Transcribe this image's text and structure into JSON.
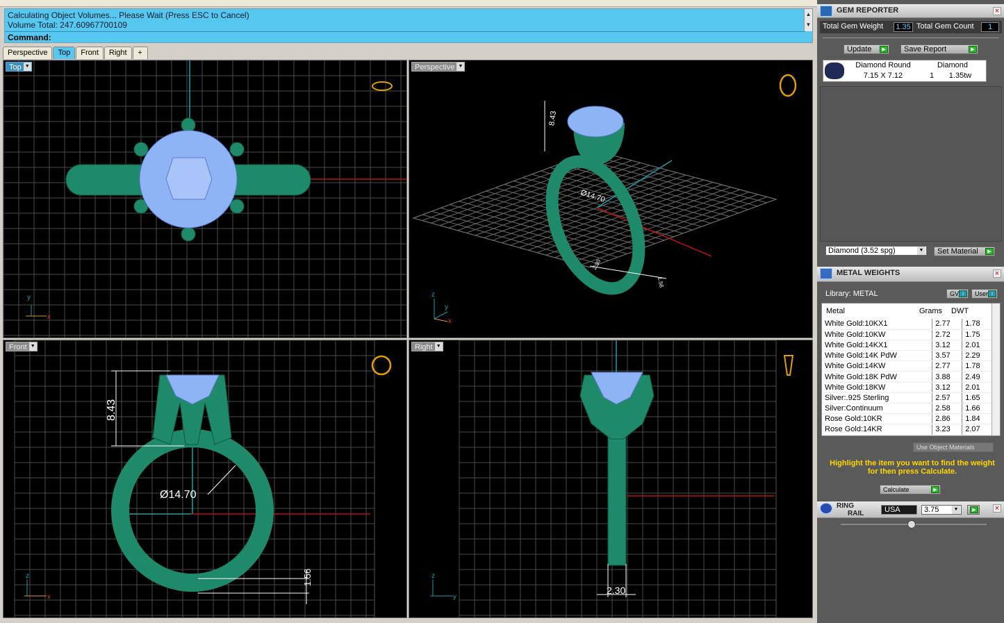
{
  "command": {
    "line1": "Calculating Object Volumes... Please Wait (Press ESC to Cancel)",
    "line2": "Volume Total: 247.60967700109",
    "prompt": "Command:"
  },
  "tabs": [
    {
      "label": "Perspective"
    },
    {
      "label": "Top"
    },
    {
      "label": "Front"
    },
    {
      "label": "Right"
    },
    {
      "label": "+"
    }
  ],
  "viewports": {
    "top": {
      "label": "Top",
      "axes": {
        "a": "y",
        "b": "x"
      }
    },
    "perspective": {
      "label": "Perspective",
      "axes": {
        "a": "z",
        "b": "y",
        "c": "x"
      },
      "dims": {
        "height": "8.43",
        "dia": "Ø14.70",
        "band": "2.30",
        "thick": "1.56"
      }
    },
    "front": {
      "label": "Front",
      "axes": {
        "a": "z",
        "b": "x"
      },
      "dims": {
        "height": "8.43",
        "dia": "Ø14.70",
        "thick": "1.56"
      }
    },
    "right": {
      "label": "Right",
      "axes": {
        "a": "z",
        "b": "y"
      },
      "dims": {
        "width": "2.30"
      }
    }
  },
  "gem_reporter": {
    "title": "GEM REPORTER",
    "total_weight_label": "Total Gem Weight",
    "total_weight": "1.35",
    "total_count_label": "Total Gem Count",
    "total_count": "1",
    "update": "Update",
    "save_report": "Save Report",
    "gem": {
      "name": "Diamond Round",
      "size": "7.15 X 7.12",
      "type": "Diamond",
      "count": "1",
      "tw": "1.35tw"
    },
    "material_select": "Diamond     (3.52 spg)",
    "set_material": "Set Material"
  },
  "metal_weights": {
    "title": "METAL WEIGHTS",
    "library_label": "Library: METAL",
    "gv": "GV",
    "user": "User",
    "headers": [
      "Metal",
      "Grams",
      "DWT"
    ],
    "rows": [
      [
        "White Gold:10KX1",
        "2.77",
        "1.78"
      ],
      [
        "White Gold:10KW",
        "2.72",
        "1.75"
      ],
      [
        "White Gold:14KX1",
        "3.12",
        "2.01"
      ],
      [
        "White Gold:14K PdW",
        "3.57",
        "2.29"
      ],
      [
        "White Gold:14KW",
        "2.77",
        "1.78"
      ],
      [
        "White Gold:18K PdW",
        "3.88",
        "2.49"
      ],
      [
        "White Gold:18KW",
        "3.12",
        "2.01"
      ],
      [
        "Silver:.925 Sterling",
        "2.57",
        "1.65"
      ],
      [
        "Silver:Continuum",
        "2.58",
        "1.66"
      ],
      [
        "Rose Gold:10KR",
        "2.86",
        "1.84"
      ],
      [
        "Rose Gold:14KR",
        "3.23",
        "2.07"
      ]
    ],
    "use_object_materials": "Use Object Materials",
    "hint": "Highlight the item you want to find the weight for then press Calculate.",
    "calculate": "Calculate"
  },
  "ring_rail": {
    "title_1": "RING",
    "title_2": "RAIL",
    "region": "USA",
    "size": "3.75"
  },
  "colors": {
    "cmd_bg": "#56c8f0",
    "metal": "#1f8a6a",
    "gem": "#8fb4f5",
    "hint_text": "#ffd700"
  }
}
